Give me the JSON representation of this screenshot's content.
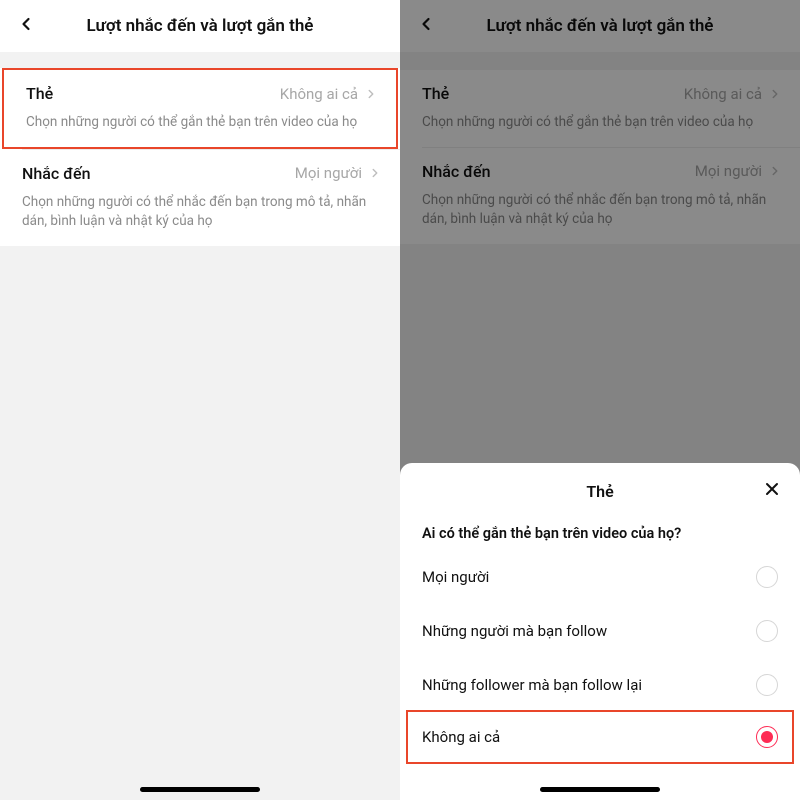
{
  "left": {
    "header_title": "Lượt nhắc đến và lượt gắn thẻ",
    "rows": {
      "tag": {
        "label": "Thẻ",
        "value": "Không ai cả",
        "desc": "Chọn những người có thể gắn thẻ bạn trên video của họ"
      },
      "mention": {
        "label": "Nhắc đến",
        "value": "Mọi người",
        "desc": "Chọn những người có thể nhắc đến bạn trong mô tả, nhãn dán, bình luận và nhật ký của họ"
      }
    }
  },
  "right": {
    "header_title": "Lượt nhắc đến và lượt gắn thẻ",
    "rows": {
      "tag": {
        "label": "Thẻ",
        "value": "Không ai cả",
        "desc": "Chọn những người có thể gắn thẻ bạn trên video của họ"
      },
      "mention": {
        "label": "Nhắc đến",
        "value": "Mọi người",
        "desc": "Chọn những người có thể nhắc đến bạn trong mô tả, nhãn dán, bình luận và nhật ký của họ"
      }
    },
    "sheet": {
      "title": "Thẻ",
      "question": "Ai có thể gắn thẻ bạn trên video của họ?",
      "options": [
        {
          "label": "Mọi người",
          "selected": false
        },
        {
          "label": "Những người mà bạn follow",
          "selected": false
        },
        {
          "label": "Những follower mà bạn follow lại",
          "selected": false
        },
        {
          "label": "Không ai cả",
          "selected": true
        }
      ]
    }
  }
}
